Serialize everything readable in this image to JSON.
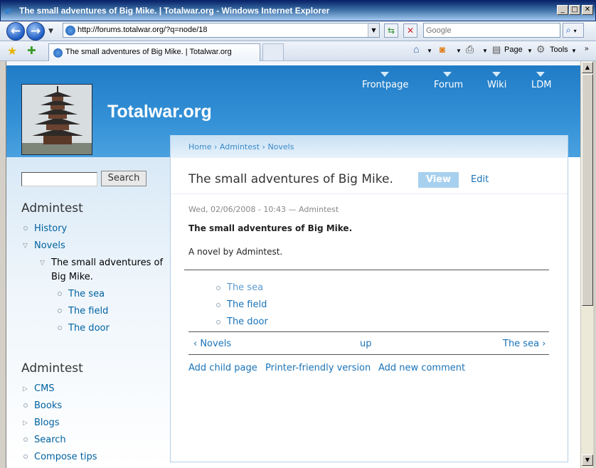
{
  "window": {
    "title": "The small adventures of Big Mike. | Totalwar.org - Windows Internet Explorer",
    "minimize_glyph": "_",
    "maximize_glyph": "□",
    "close_glyph": "✕"
  },
  "addressbar": {
    "url": "http://forums.totalwar.org/?q=node/18",
    "search_placeholder": "Google",
    "back_icon": "back-arrow-icon",
    "forward_icon": "forward-arrow-icon"
  },
  "tabbar": {
    "tab_label": "The small adventures of Big Mike. | Totalwar.org",
    "page_menu": "Page",
    "tools_menu": "Tools"
  },
  "site": {
    "name": "Totalwar.org",
    "primary_links": [
      "Frontpage",
      "Forum",
      "Wiki",
      "LDM"
    ]
  },
  "sidebar": {
    "search_value": "",
    "search_button": "Search",
    "block1": {
      "title": "Admintest",
      "items": [
        "History",
        "Novels",
        "The small adventures of",
        "Big Mike.",
        "The sea",
        "The field",
        "The door"
      ]
    },
    "block2": {
      "title": "Admintest",
      "items": [
        "CMS",
        "Books",
        "Blogs",
        "Search",
        "Compose tips"
      ]
    }
  },
  "content": {
    "breadcrumb": "Home › Admintest › Novels",
    "title": "The small adventures of Big Mike.",
    "tabs": {
      "view": "View",
      "edit": "Edit"
    },
    "submitted": "Wed, 02/06/2008 - 10:43 — Admintest",
    "body_strong": "The small adventures of Big Mike.",
    "body_text": "A novel by Admintest.",
    "book_children": [
      "The sea",
      "The field",
      "The door"
    ],
    "pager": {
      "prev": "‹ Novels",
      "up": "up",
      "next": "The sea ›"
    },
    "links": [
      "Add child page",
      "Printer-friendly version",
      "Add new comment"
    ]
  }
}
